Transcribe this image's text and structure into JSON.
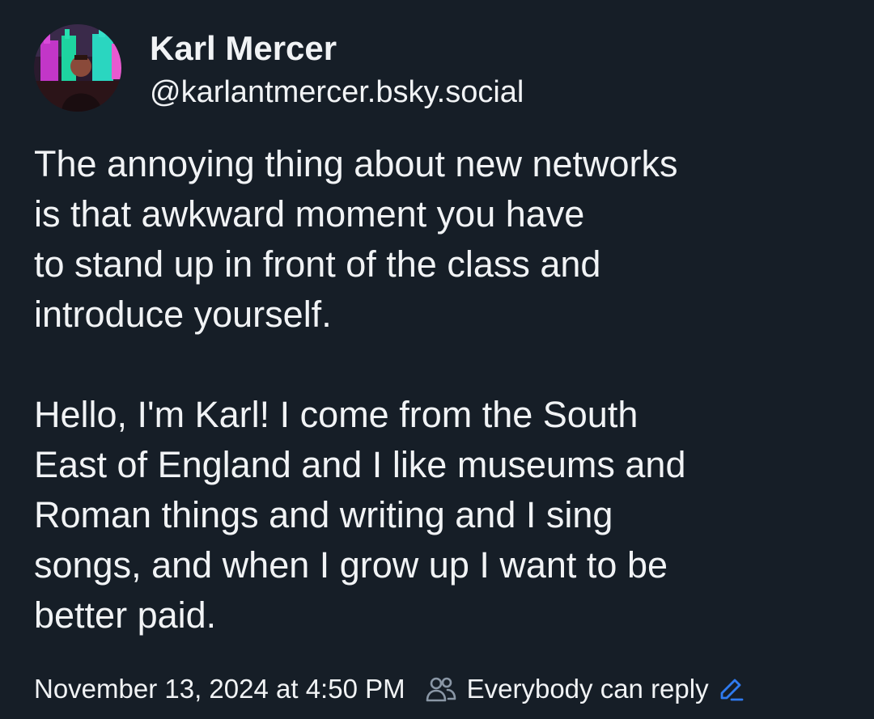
{
  "colors": {
    "background": "#161e27",
    "text": "#f1f3f5",
    "muted_icon": "#8a97a6",
    "accent": "#2f7bf0"
  },
  "author": {
    "display_name": "Karl Mercer",
    "handle": "@karlantmercer.bsky.social",
    "avatar_icon": "user-avatar-photo"
  },
  "post": {
    "paragraphs": [
      [
        "The annoying thing about new networks",
        "is that awkward moment you have",
        "to stand up in front of the class and",
        "introduce yourself."
      ],
      [
        "Hello, I'm Karl! I come from the South",
        "East of England and I like museums and",
        "Roman things and writing and I sing",
        "songs, and when I grow up I want to be",
        "better paid."
      ]
    ]
  },
  "meta": {
    "timestamp": "November 13, 2024 at 4:50 PM",
    "reply_setting": "Everybody can reply",
    "reply_icon": "people-icon",
    "edit_icon": "pencil-icon"
  }
}
